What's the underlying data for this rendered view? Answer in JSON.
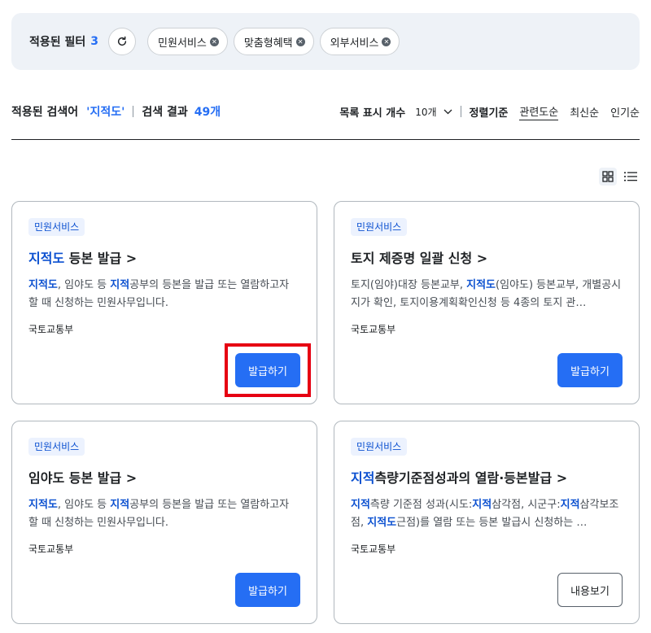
{
  "filters": {
    "title": "적용된 필터",
    "count": "3",
    "chips": [
      "민원서비스",
      "맞춤형혜택",
      "외부서비스"
    ]
  },
  "summary": {
    "keyword_label": "적용된 검색어",
    "keyword": "'지적도'",
    "result_label": "검색 결과",
    "result_count": "49개",
    "list_count_label": "목록 표시 개수",
    "list_count_value": "10개",
    "sort_label": "정렬기준",
    "sort_options": [
      "관련도순",
      "최신순",
      "인기순"
    ],
    "sort_active": "관련도순"
  },
  "cards": [
    {
      "badge": "민원서비스",
      "title_hl": "지적도",
      "title_rest": " 등본 발급",
      "arrow": ">",
      "desc": [
        {
          "t": "지적도",
          "h": true
        },
        {
          "t": ", 임야도 등 ",
          "h": false
        },
        {
          "t": "지적",
          "h": true
        },
        {
          "t": "공부의 등본을 발급 또는 열람하고자 할 때 신청하는 민원사무입니다.",
          "h": false
        }
      ],
      "org": "국토교통부",
      "button": "발급하기",
      "button_style": "primary"
    },
    {
      "badge": "민원서비스",
      "title_hl": "",
      "title_rest": "토지 제증명 일괄 신청",
      "arrow": ">",
      "desc": [
        {
          "t": "토지(임야)대장 등본교부, ",
          "h": false
        },
        {
          "t": "지적도",
          "h": true
        },
        {
          "t": "(임야도) 등본교부, 개별공시지가 확인, 토지이용계획확인신청 등 4종의 토지 관…",
          "h": false
        }
      ],
      "org": "국토교통부",
      "button": "발급하기",
      "button_style": "primary"
    },
    {
      "badge": "민원서비스",
      "title_hl": "",
      "title_rest": "임야도 등본 발급",
      "arrow": ">",
      "desc": [
        {
          "t": "지적도",
          "h": true
        },
        {
          "t": ", 임야도 등 ",
          "h": false
        },
        {
          "t": "지적",
          "h": true
        },
        {
          "t": "공부의 등본을 발급 또는 열람하고자 할 때 신청하는 민원사무입니다.",
          "h": false
        }
      ],
      "org": "국토교통부",
      "button": "발급하기",
      "button_style": "primary"
    },
    {
      "badge": "민원서비스",
      "title_hl": "지적",
      "title_rest": "측량기준점성과의 열람·등본발급",
      "arrow": ">",
      "desc": [
        {
          "t": "지적",
          "h": true
        },
        {
          "t": "측량 기준점 성과(시도:",
          "h": false
        },
        {
          "t": "지적",
          "h": true
        },
        {
          "t": "삼각점, 시군구:",
          "h": false
        },
        {
          "t": "지적",
          "h": true
        },
        {
          "t": "삼각보조점, ",
          "h": false
        },
        {
          "t": "지적도",
          "h": true
        },
        {
          "t": "근점)를 열람 또는 등본 발급시 신청하는 …",
          "h": false
        }
      ],
      "org": "국토교통부",
      "button": "내용보기",
      "button_style": "outline"
    }
  ],
  "colors": {
    "accent": "#256ef4",
    "highlight_text": "#0b50d0",
    "annotation": "#e60012"
  }
}
